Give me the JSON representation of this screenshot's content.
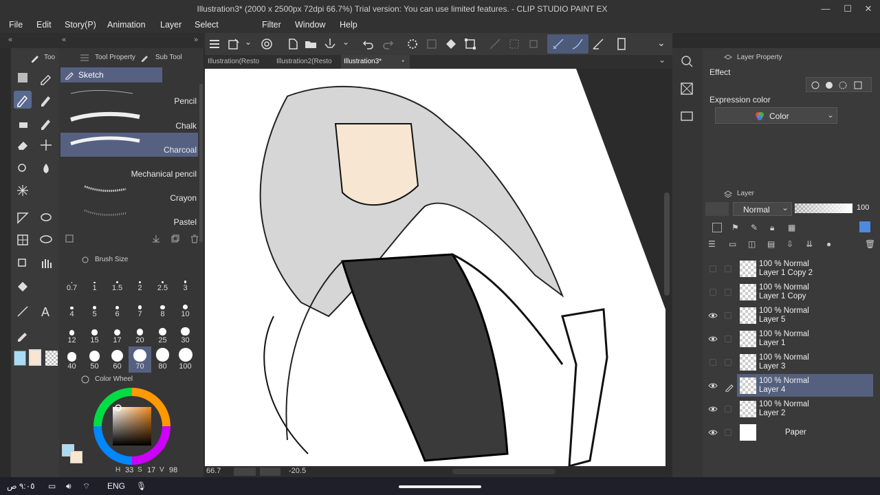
{
  "window": {
    "title": "Illustration3* (2000 x 2500px 72dpi 66.7%)  Trial version: You can use limited features. - CLIP STUDIO PAINT EX",
    "minimize": "—",
    "maximize": "☐",
    "close": "✕"
  },
  "menu": [
    "File",
    "Edit",
    "Story(P)",
    "Animation",
    "Layer",
    "Select",
    "Filter",
    "Window",
    "Help"
  ],
  "canvas_tabs": [
    {
      "label": "Illustration(Resto",
      "active": false
    },
    {
      "label": "Illustration2(Resto",
      "active": false
    },
    {
      "label": "Illustration3*",
      "active": true
    }
  ],
  "tool_panel": {
    "tab_label": "Too",
    "subtool_tabs": [
      "Tool Property",
      "Sub Tool"
    ],
    "group": "Sketch",
    "brushes": [
      {
        "label": "Pencil",
        "active": false
      },
      {
        "label": "Chalk",
        "active": false
      },
      {
        "label": "Charcoal",
        "active": true
      },
      {
        "label": "Mechanical pencil",
        "active": false
      },
      {
        "label": "Crayon",
        "active": false
      },
      {
        "label": "Pastel",
        "active": false
      }
    ]
  },
  "brush_size": {
    "title": "Brush Size",
    "sizes": [
      "0.7",
      "1",
      "1.5",
      "2",
      "2.5",
      "3",
      "4",
      "5",
      "6",
      "7",
      "8",
      "10",
      "12",
      "15",
      "17",
      "20",
      "25",
      "30",
      "40",
      "50",
      "60",
      "70",
      "80",
      "100"
    ],
    "selected": "70"
  },
  "color_wheel": {
    "title": "Color Wheel",
    "h_label": "H",
    "h_value": "33",
    "s_label": "S",
    "s_value": "17",
    "v_label": "V",
    "v_value": "98",
    "main_color": "#f9e6d0",
    "sub_color": "#a8dcf5"
  },
  "canvas_status": {
    "zoom": "66.7",
    "angle": "-20.5"
  },
  "layer_property": {
    "title": "Layer Property",
    "effect_label": "Effect",
    "expression_color_label": "Expression color",
    "expression_color_value": "Color"
  },
  "layer_panel": {
    "title": "Layer",
    "blend_mode": "Normal",
    "opacity": "100",
    "layers": [
      {
        "info": "100 % Normal",
        "name": "Layer 1 Copy 2",
        "visible": false,
        "active": false
      },
      {
        "info": "100 % Normal",
        "name": "Layer 1 Copy",
        "visible": false,
        "active": false
      },
      {
        "info": "100 % Normal",
        "name": "Layer 5",
        "visible": true,
        "active": false
      },
      {
        "info": "100 % Normal",
        "name": "Layer 1",
        "visible": true,
        "active": false
      },
      {
        "info": "100 % Normal",
        "name": "Layer 3",
        "visible": false,
        "active": false
      },
      {
        "info": "100 % Normal",
        "name": "Layer 4",
        "visible": true,
        "active": true
      },
      {
        "info": "100 % Normal",
        "name": "Layer 2",
        "visible": true,
        "active": false
      },
      {
        "info": "",
        "name": "Paper",
        "visible": true,
        "active": false
      }
    ]
  },
  "taskbar": {
    "time": "٩:٠٥ ص",
    "language": "ENG"
  },
  "colors": {
    "accent": "#566182",
    "panel": "#3a3a3a",
    "background": "#2b2b2b"
  }
}
